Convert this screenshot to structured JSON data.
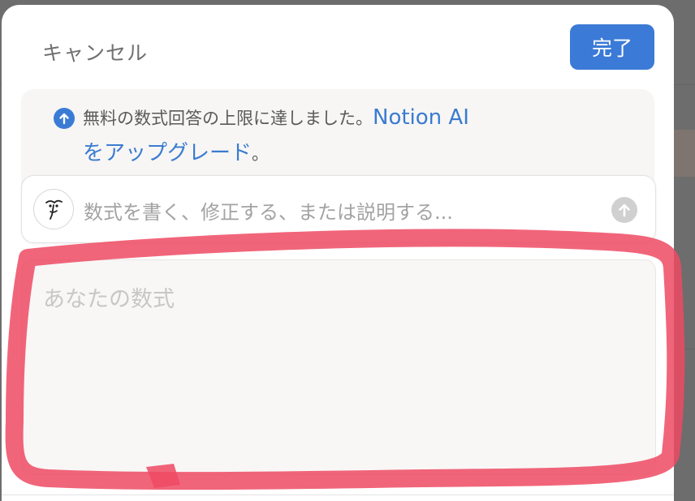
{
  "header": {
    "cancel_label": "キャンセル",
    "done_label": "完了"
  },
  "notice": {
    "icon": "arrow-up-circle-icon",
    "text_before": "無料の数式回答の上限に達しました。",
    "link_part1": "Notion AI",
    "link_part2": "をアップグレード",
    "text_after": "。"
  },
  "ai_prompt": {
    "avatar_icon": "notion-ai-face-icon",
    "placeholder": "数式を書く、修正する、または説明する...",
    "send_icon": "arrow-up-icon"
  },
  "formula": {
    "placeholder": "あなたの数式"
  },
  "colors": {
    "accent": "#3b7ad6",
    "highlight": "#ee4a63"
  }
}
